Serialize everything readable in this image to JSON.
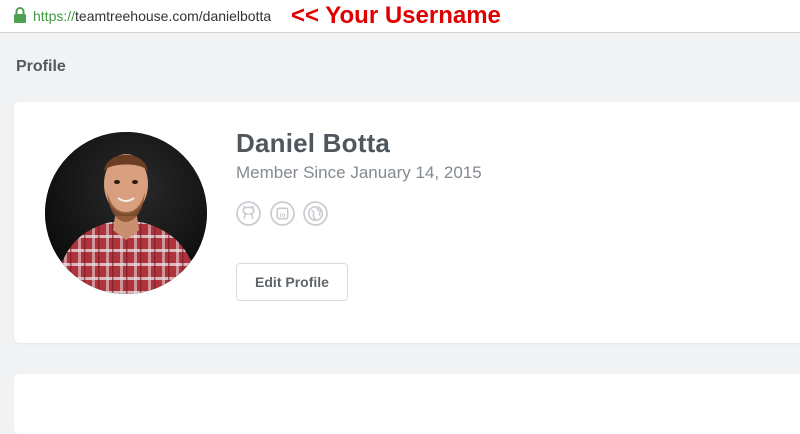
{
  "browser": {
    "url_scheme": "https://",
    "url_rest": "teamtreehouse.com/danielbotta",
    "lock_icon": "lock-icon"
  },
  "annotation": "<< Your Username",
  "page": {
    "heading": "Profile"
  },
  "profile": {
    "name": "Daniel Botta",
    "member_since": "Member Since January 14, 2015",
    "avatar": "profile-photo",
    "social_icons": [
      "github-icon",
      "linkedin-icon",
      "globe-icon"
    ],
    "edit_label": "Edit Profile"
  },
  "colors": {
    "annotation": "#e00000",
    "secure": "#3e9b3e",
    "background": "#f1f2f4",
    "card": "#ffffff"
  }
}
